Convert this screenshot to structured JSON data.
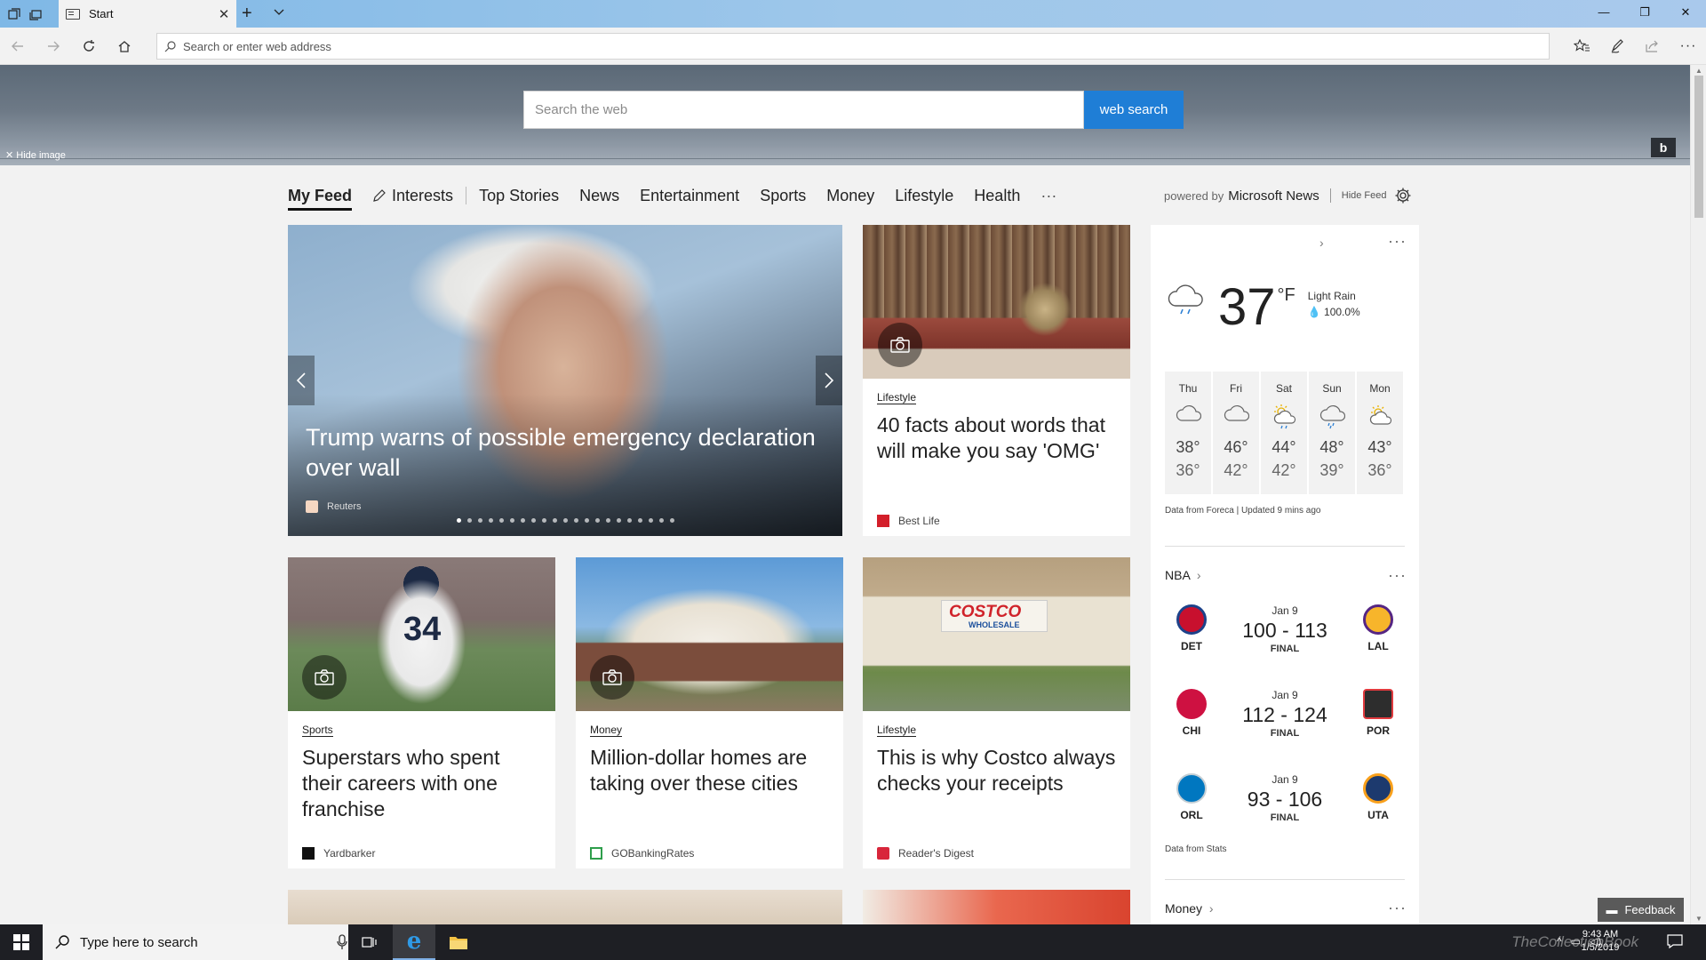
{
  "browser": {
    "tab_title": "Start",
    "address_placeholder": "Search or enter web address"
  },
  "hero": {
    "search_placeholder": "Search the web",
    "search_button": "web search",
    "hide_image": "Hide image",
    "bing_label": "b"
  },
  "feed_nav": {
    "items": [
      "My Feed",
      "Interests",
      "Top Stories",
      "News",
      "Entertainment",
      "Sports",
      "Money",
      "Lifestyle",
      "Health",
      "···"
    ],
    "powered_by": "powered by",
    "brand": "Microsoft News",
    "hide_feed": "Hide Feed"
  },
  "cards": {
    "featured": {
      "headline": "Trump warns of possible emergency declaration over wall",
      "source": "Reuters",
      "slide_count": 21,
      "active_slide": 1
    },
    "words": {
      "category": "Lifestyle",
      "headline": "40 facts about words that will make you say 'OMG'",
      "source": "Best Life"
    },
    "superstars": {
      "category": "Sports",
      "headline": "Superstars who spent their careers with one franchise",
      "source": "Yardbarker"
    },
    "homes": {
      "category": "Money",
      "headline": "Million-dollar homes are taking over these cities",
      "source": "GOBankingRates"
    },
    "costco": {
      "category": "Lifestyle",
      "headline": "This is why Costco always checks your receipts",
      "source": "Reader's Digest",
      "sign_text": "COSTCO",
      "sign_sub": "WHOLESALE"
    },
    "jersey_number": "34"
  },
  "weather": {
    "temp": "37",
    "unit": "°F",
    "condition": "Light Rain",
    "precip": "100.0%",
    "forecast": [
      {
        "day": "Thu",
        "hi": "38°",
        "lo": "36°",
        "icon": "cloudy-icon"
      },
      {
        "day": "Fri",
        "hi": "46°",
        "lo": "42°",
        "icon": "cloudy-icon"
      },
      {
        "day": "Sat",
        "hi": "44°",
        "lo": "42°",
        "icon": "sun-rain-icon"
      },
      {
        "day": "Sun",
        "hi": "48°",
        "lo": "39°",
        "icon": "rain-icon"
      },
      {
        "day": "Mon",
        "hi": "43°",
        "lo": "36°",
        "icon": "partly-sunny-icon"
      }
    ],
    "source": "Data from Foreca | Updated 9 mins ago"
  },
  "nba": {
    "title": "NBA",
    "games": [
      {
        "date": "Jan 9",
        "score": "100 - 113",
        "status": "FINAL",
        "home": "DET",
        "away": "LAL",
        "home_color": "#c8102e",
        "away_color": "#f7b52b"
      },
      {
        "date": "Jan 9",
        "score": "112 - 124",
        "status": "FINAL",
        "home": "CHI",
        "away": "POR",
        "home_color": "#ce1141",
        "away_color": "#2d2d2d"
      },
      {
        "date": "Jan 9",
        "score": "93 - 106",
        "status": "FINAL",
        "home": "ORL",
        "away": "UTA",
        "home_color": "#0077c0",
        "away_color": "#1d3a6e"
      }
    ],
    "source": "Data from Stats"
  },
  "money_title": "Money",
  "feedback": "Feedback",
  "taskbar": {
    "search_placeholder": "Type here to search",
    "time": "9:43 AM",
    "date": "1/5/2019",
    "watermark": "TheCollectionBook"
  },
  "colors": {
    "accent_blue": "#1f7ed6",
    "titlebar": "#9ec7ea",
    "taskbar": "#1e1f24"
  }
}
